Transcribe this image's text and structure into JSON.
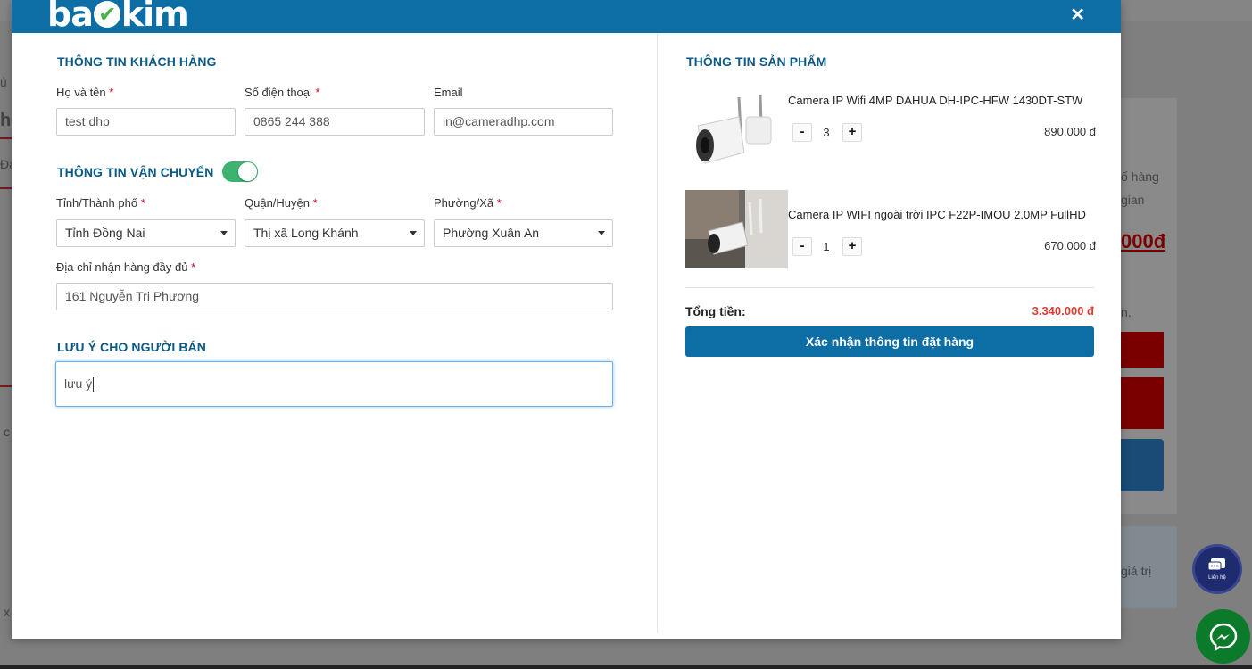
{
  "app": {
    "logo_text_left": "ba",
    "logo_text_right": "kim"
  },
  "colors": {
    "header": "#0c6ea5",
    "title": "#0c5a86",
    "total": "#e03c31",
    "toggle_on": "#3cb371"
  },
  "customer": {
    "title": "THÔNG TIN KHÁCH HÀNG",
    "name_label": "Họ và tên",
    "name_value": "test dhp",
    "phone_label": "Số điện thoại",
    "phone_value": "0865 244 388",
    "email_label": "Email",
    "email_value": "in@cameradhp.com",
    "required_mark": "*"
  },
  "shipping": {
    "title": "THÔNG TIN VẬN CHUYỂN",
    "toggle_on": true,
    "province_label": "Tỉnh/Thành phố",
    "province_value": "Tỉnh Đồng Nai",
    "district_label": "Quận/Huyện",
    "district_value": "Thị xã Long Khánh",
    "ward_label": "Phường/Xã",
    "ward_value": "Phường Xuân An",
    "address_label": "Địa chỉ nhận hàng đầy đủ",
    "address_value": "161 Nguyễn Tri Phương"
  },
  "note": {
    "title": "LƯU Ý CHO NGƯỜI BÁN",
    "value": "lưu ý"
  },
  "products": {
    "title": "THÔNG TIN SẢN PHẨM",
    "items": [
      {
        "name": "Camera IP Wifi 4MP DAHUA DH-IPC-HFW 1430DT-STW",
        "qty": "3",
        "price": "890.000 đ",
        "minus": "-",
        "plus": "+"
      },
      {
        "name": "Camera IP WIFI ngoài trời IPC F22P-IMOU 2.0MP FullHD",
        "qty": "1",
        "price": "670.000 đ",
        "minus": "-",
        "plus": "+"
      }
    ]
  },
  "summary": {
    "total_label": "Tổng tiền:",
    "total_value": "3.340.000 đ",
    "confirm_label": "Xác nhận thông tin đặt hàng"
  },
  "background": {
    "price_fragment": "000đ",
    "text_1": "ủ",
    "text_2": "h",
    "text_3": "Đa",
    "text_4": "c",
    "text_5": "x",
    "text_6": "ố hàng",
    "text_7": "gian",
    "text_8": "n.",
    "text_9": "giá trị",
    "chat_label": "Liên hệ"
  },
  "icons": {
    "close": "close-icon",
    "chat": "chat-icon",
    "messenger": "messenger-icon",
    "caret": "chevron-down-icon"
  }
}
